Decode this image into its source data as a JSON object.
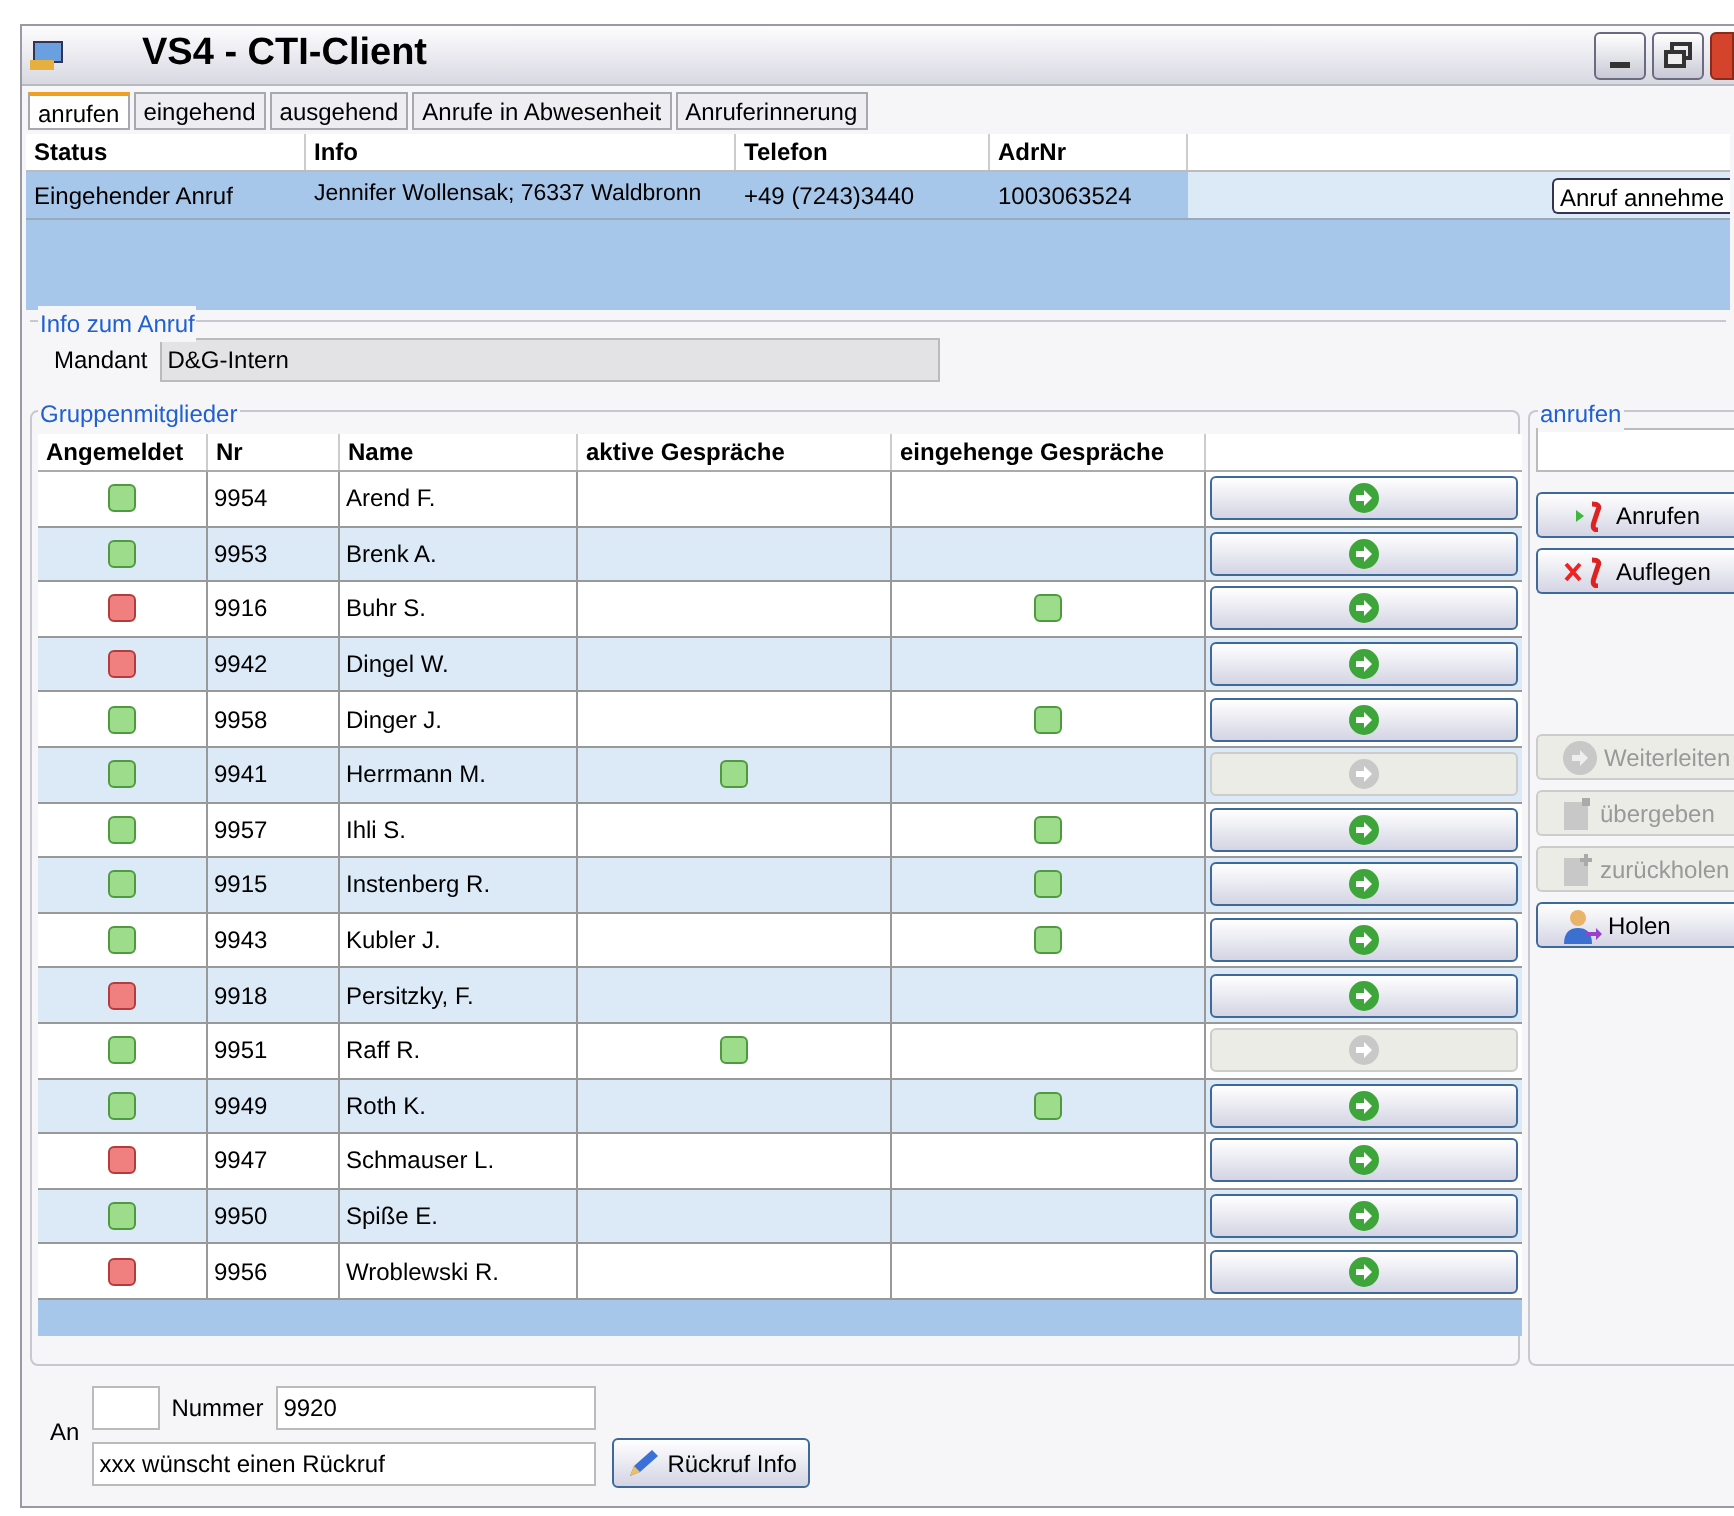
{
  "window": {
    "title": "VS4 - CTI-Client"
  },
  "tabs": [
    {
      "label": "anrufen",
      "selected": true
    },
    {
      "label": "eingehend",
      "selected": false
    },
    {
      "label": "ausgehend",
      "selected": false
    },
    {
      "label": "Anrufe in Abwesenheit",
      "selected": false
    },
    {
      "label": "Anruferinnerung",
      "selected": false
    }
  ],
  "calls": {
    "columns": [
      "Status",
      "Info",
      "Telefon",
      "AdrNr"
    ],
    "rows": [
      {
        "status": "Eingehender Anruf",
        "info": "Jennifer Wollensak; 76337 Waldbronn",
        "telefon": "+49 (7243)3440",
        "adrnr": "1003063524",
        "action": "Anruf annehme",
        "selected": true
      }
    ]
  },
  "info": {
    "legend": "Info zum Anruf",
    "label": "Mandant",
    "value": "D&G-Intern"
  },
  "group": {
    "legend": "Gruppenmitglieder",
    "columns": [
      "Angemeldet",
      "Nr",
      "Name",
      "aktive Gespräche",
      "eingehenge Gespräche"
    ],
    "rows": [
      {
        "logged_in": true,
        "nr": "9954",
        "name": "Arend F.",
        "active": false,
        "incoming": false,
        "disabled": false
      },
      {
        "logged_in": true,
        "nr": "9953",
        "name": "Brenk A.",
        "active": false,
        "incoming": false,
        "disabled": false
      },
      {
        "logged_in": false,
        "nr": "9916",
        "name": "Buhr S.",
        "active": false,
        "incoming": true,
        "disabled": false
      },
      {
        "logged_in": false,
        "nr": "9942",
        "name": "Dingel W.",
        "active": false,
        "incoming": false,
        "disabled": false
      },
      {
        "logged_in": true,
        "nr": "9958",
        "name": "Dinger J.",
        "active": false,
        "incoming": true,
        "disabled": false
      },
      {
        "logged_in": true,
        "nr": "9941",
        "name": "Herrmann M.",
        "active": true,
        "incoming": false,
        "disabled": true
      },
      {
        "logged_in": true,
        "nr": "9957",
        "name": "Ihli S.",
        "active": false,
        "incoming": true,
        "disabled": false
      },
      {
        "logged_in": true,
        "nr": "9915",
        "name": "Instenberg R.",
        "active": false,
        "incoming": true,
        "disabled": false
      },
      {
        "logged_in": true,
        "nr": "9943",
        "name": "Kubler J.",
        "active": false,
        "incoming": true,
        "disabled": false
      },
      {
        "logged_in": false,
        "nr": "9918",
        "name": "Persitzky, F.",
        "active": false,
        "incoming": false,
        "disabled": false
      },
      {
        "logged_in": true,
        "nr": "9951",
        "name": "Raff R.",
        "active": true,
        "incoming": false,
        "disabled": true
      },
      {
        "logged_in": true,
        "nr": "9949",
        "name": "Roth K.",
        "active": false,
        "incoming": true,
        "disabled": false
      },
      {
        "logged_in": false,
        "nr": "9947",
        "name": "Schmauser L.",
        "active": false,
        "incoming": false,
        "disabled": false
      },
      {
        "logged_in": true,
        "nr": "9950",
        "name": "Spiße E.",
        "active": false,
        "incoming": false,
        "disabled": false
      },
      {
        "logged_in": false,
        "nr": "9956",
        "name": "Wroblewski R.",
        "active": false,
        "incoming": false,
        "disabled": false
      }
    ]
  },
  "call_panel": {
    "legend": "anrufen",
    "buttons": [
      {
        "kind": "call",
        "label": "Anrufen",
        "disabled": false
      },
      {
        "kind": "hangup",
        "label": "Auflegen",
        "disabled": false
      },
      {
        "kind": "spacer"
      },
      {
        "kind": "forward",
        "label": "Weiterleiten",
        "disabled": true
      },
      {
        "kind": "transfer",
        "label": "übergeben",
        "disabled": true
      },
      {
        "kind": "retrieve",
        "label": "zurückholen",
        "disabled": true
      },
      {
        "kind": "pickup",
        "label": "Holen",
        "disabled": false
      }
    ]
  },
  "callback": {
    "an_label": "An",
    "nummer_label": "Nummer",
    "nummer": "9920",
    "message": "xxx wünscht einen Rückruf",
    "button": "Rückruf Info"
  }
}
